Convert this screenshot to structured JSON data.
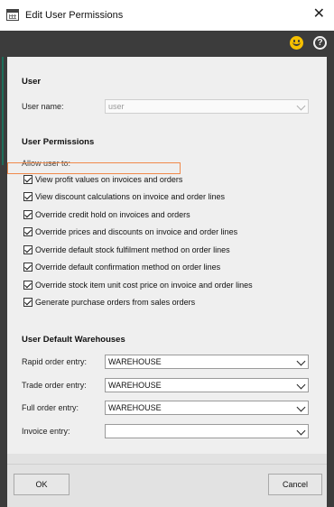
{
  "window": {
    "title": "Edit User Permissions",
    "close_glyph": "✕",
    "icon": "app-grid-icon"
  },
  "toolbar": {
    "smiley_icon": "smiley-icon",
    "help_glyph": "?"
  },
  "user": {
    "section_title": "User",
    "username_label": "User name:",
    "username_value": "user"
  },
  "permissions": {
    "section_title": "User Permissions",
    "allow_label": "Allow user to:",
    "items": [
      {
        "label": "View profit values on invoices and orders",
        "checked": true
      },
      {
        "label": "View discount calculations on invoice and order lines",
        "checked": true
      },
      {
        "label": "Override credit hold on invoices and orders",
        "checked": true
      },
      {
        "label": "Override prices and discounts on invoice and order lines",
        "checked": true
      },
      {
        "label": "Override default stock fulfilment method on order lines",
        "checked": true
      },
      {
        "label": "Override default confirmation method on order lines",
        "checked": true
      },
      {
        "label": "Override stock item unit cost price on invoice and order lines",
        "checked": true
      },
      {
        "label": "Generate purchase orders from sales orders",
        "checked": true
      }
    ]
  },
  "warehouses": {
    "section_title": "User Default Warehouses",
    "rows": [
      {
        "label": "Rapid order entry:",
        "value": "WAREHOUSE"
      },
      {
        "label": "Trade order entry:",
        "value": "WAREHOUSE"
      },
      {
        "label": "Full order entry:",
        "value": "WAREHOUSE"
      },
      {
        "label": "Invoice entry:",
        "value": ""
      }
    ]
  },
  "buttons": {
    "ok": "OK",
    "cancel": "Cancel"
  },
  "colors": {
    "dark_bar": "#3c3c3c",
    "panel": "#efefef",
    "accent_smiley": "#f6c000",
    "highlight": "#f08a4b"
  }
}
